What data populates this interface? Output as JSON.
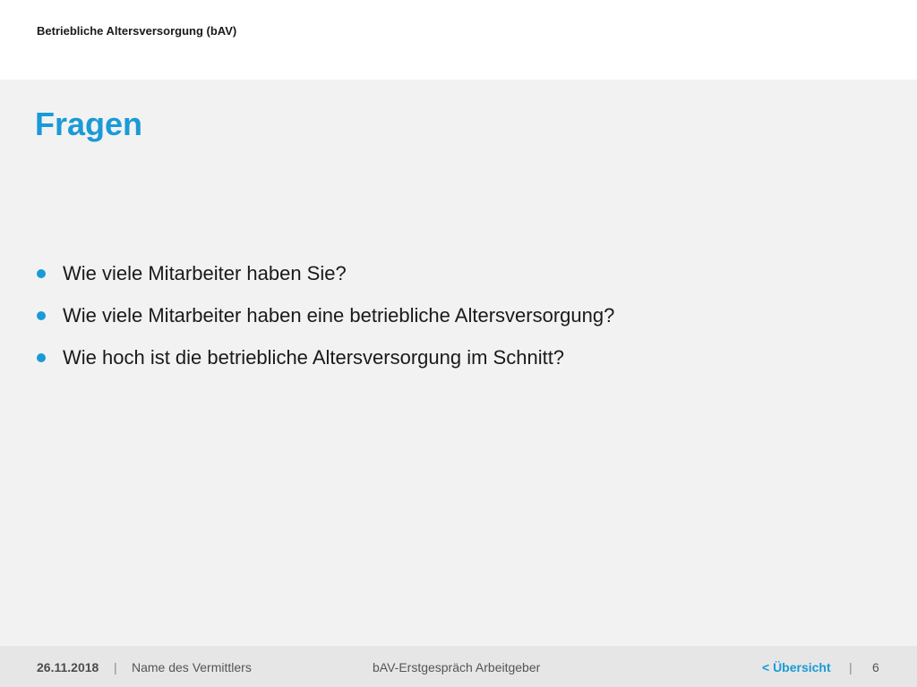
{
  "header": {
    "title": "Betriebliche Altersversorgung (bAV)"
  },
  "slide": {
    "title": "Fragen",
    "bullets": [
      "Wie viele Mitarbeiter haben Sie?",
      "Wie viele Mitarbeiter haben eine betriebliche Altersversorgung?",
      "Wie hoch ist die betriebliche Altersversorgung im Schnitt?"
    ]
  },
  "footer": {
    "date": "26.11.2018",
    "separator": "|",
    "name": "Name des Vermittlers",
    "center": "bAV-Erstgespräch Arbeitgeber",
    "overview_link": "< Übersicht",
    "page_number": "6"
  },
  "colors": {
    "accent": "#1a9ad6",
    "background": "#f2f2f2",
    "header_background": "#ffffff",
    "footer_background": "#e6e6e6"
  },
  "icons": {
    "bullet": "bullet-dot-icon"
  }
}
